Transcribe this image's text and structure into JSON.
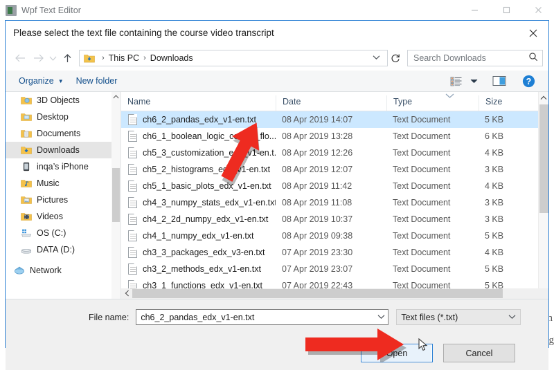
{
  "app": {
    "title": "Wpf Text Editor",
    "icon": "app-square-icon",
    "window_controls": [
      {
        "name": "minimize",
        "glyph": "minimize-icon"
      },
      {
        "name": "maximize",
        "glyph": "maximize-icon"
      },
      {
        "name": "close",
        "glyph": "close-icon"
      }
    ],
    "background_text": {
      "line1": "en",
      "line2": "rog"
    }
  },
  "dialog": {
    "title": "Please select the text file containing the course video transcript",
    "close_label": "✕"
  },
  "navbar": {
    "back": "back-arrow-icon",
    "forward": "forward-arrow-icon",
    "recent": "recent-locations-icon",
    "up": "up-arrow-icon",
    "breadcrumb": {
      "folder_icon": "downloads-folder-icon",
      "parts": [
        "This PC",
        "Downloads"
      ],
      "separator": "›",
      "dropdown": "chevron-down-icon"
    },
    "refresh": "refresh-icon"
  },
  "search": {
    "placeholder": "Search Downloads",
    "value": "",
    "icon": "search-icon"
  },
  "commandbar": {
    "organize": "Organize",
    "new_folder": "New folder",
    "view_icon": "view-options-icon",
    "view_caret": "chevron-down-icon",
    "preview_icon": "preview-pane-icon",
    "help_icon": "help-icon"
  },
  "sidebar": {
    "items": [
      {
        "label": "3D Objects",
        "icon": "folder-3d-icon",
        "selected": false,
        "color": "#f5c24a"
      },
      {
        "label": "Desktop",
        "icon": "folder-desktop-icon",
        "selected": false,
        "color": "#f5c24a"
      },
      {
        "label": "Documents",
        "icon": "folder-documents-icon",
        "selected": false,
        "color": "#f5c24a"
      },
      {
        "label": "Downloads",
        "icon": "folder-downloads-icon",
        "selected": true,
        "color": "#f5c24a"
      },
      {
        "label": "inqa’s iPhone",
        "icon": "iphone-icon",
        "selected": false,
        "color": "#5b646d"
      },
      {
        "label": "Music",
        "icon": "folder-music-icon",
        "selected": false,
        "color": "#f5c24a"
      },
      {
        "label": "Pictures",
        "icon": "folder-pictures-icon",
        "selected": false,
        "color": "#f5c24a"
      },
      {
        "label": "Videos",
        "icon": "folder-videos-icon",
        "selected": false,
        "color": "#f5c24a"
      },
      {
        "label": "OS (C:)",
        "icon": "os-drive-icon",
        "selected": false,
        "color": "#d9dde1"
      },
      {
        "label": "DATA (D:)",
        "icon": "disk-drive-icon",
        "selected": false,
        "color": "#d9dde1"
      },
      {
        "label": "Network",
        "icon": "network-icon",
        "selected": false,
        "color": "#7aaed6"
      }
    ]
  },
  "filelist": {
    "columns": [
      "Name",
      "Date",
      "Type",
      "Size"
    ],
    "sort_column": "Date",
    "sort_indicator": "chevron-down-icon",
    "rows": [
      {
        "name": "ch6_2_pandas_edx_v1-en.txt",
        "date": "08 Apr 2019 14:07",
        "type": "Text Document",
        "size": "5 KB",
        "selected": true
      },
      {
        "name": "ch6_1_boolean_logic_control_flo...",
        "date": "08 Apr 2019 13:28",
        "type": "Text Document",
        "size": "6 KB",
        "selected": false
      },
      {
        "name": "ch5_3_customization_edx_v1-en.t...",
        "date": "08 Apr 2019 12:26",
        "type": "Text Document",
        "size": "4 KB",
        "selected": false
      },
      {
        "name": "ch5_2_histograms_edx_v1-en.txt",
        "date": "08 Apr 2019 12:07",
        "type": "Text Document",
        "size": "3 KB",
        "selected": false
      },
      {
        "name": "ch5_1_basic_plots_edx_v1-en.txt",
        "date": "08 Apr 2019 11:42",
        "type": "Text Document",
        "size": "4 KB",
        "selected": false
      },
      {
        "name": "ch4_3_numpy_stats_edx_v1-en.txt",
        "date": "08 Apr 2019 11:08",
        "type": "Text Document",
        "size": "3 KB",
        "selected": false
      },
      {
        "name": "ch4_2_2d_numpy_edx_v1-en.txt",
        "date": "08 Apr 2019 10:37",
        "type": "Text Document",
        "size": "3 KB",
        "selected": false
      },
      {
        "name": "ch4_1_numpy_edx_v1-en.txt",
        "date": "08 Apr 2019 09:38",
        "type": "Text Document",
        "size": "5 KB",
        "selected": false
      },
      {
        "name": "ch3_3_packages_edx_v3-en.txt",
        "date": "07 Apr 2019 23:30",
        "type": "Text Document",
        "size": "4 KB",
        "selected": false
      },
      {
        "name": "ch3_2_methods_edx_v1-en.txt",
        "date": "07 Apr 2019 23:07",
        "type": "Text Document",
        "size": "5 KB",
        "selected": false
      },
      {
        "name": "ch3_1_functions_edx_v1-en.txt",
        "date": "07 Apr 2019 22:43",
        "type": "Text Document",
        "size": "5 KB",
        "selected": false
      }
    ]
  },
  "footer": {
    "filename_label": "File name:",
    "filename_value": "ch6_2_pandas_edx_v1-en.txt",
    "filename_caret": "chevron-down-icon",
    "filter_value": "Text files (*.txt)",
    "filter_caret": "chevron-down-icon",
    "open_button": "Open",
    "cancel_button": "Cancel"
  },
  "annotations": {
    "arrow_color": "#ee2b20",
    "arrow_on_list": "red-arrow-pointing-to-selected-file",
    "arrow_on_open": "red-arrow-pointing-to-open-button",
    "cursor": "mouse-cursor-icon"
  }
}
